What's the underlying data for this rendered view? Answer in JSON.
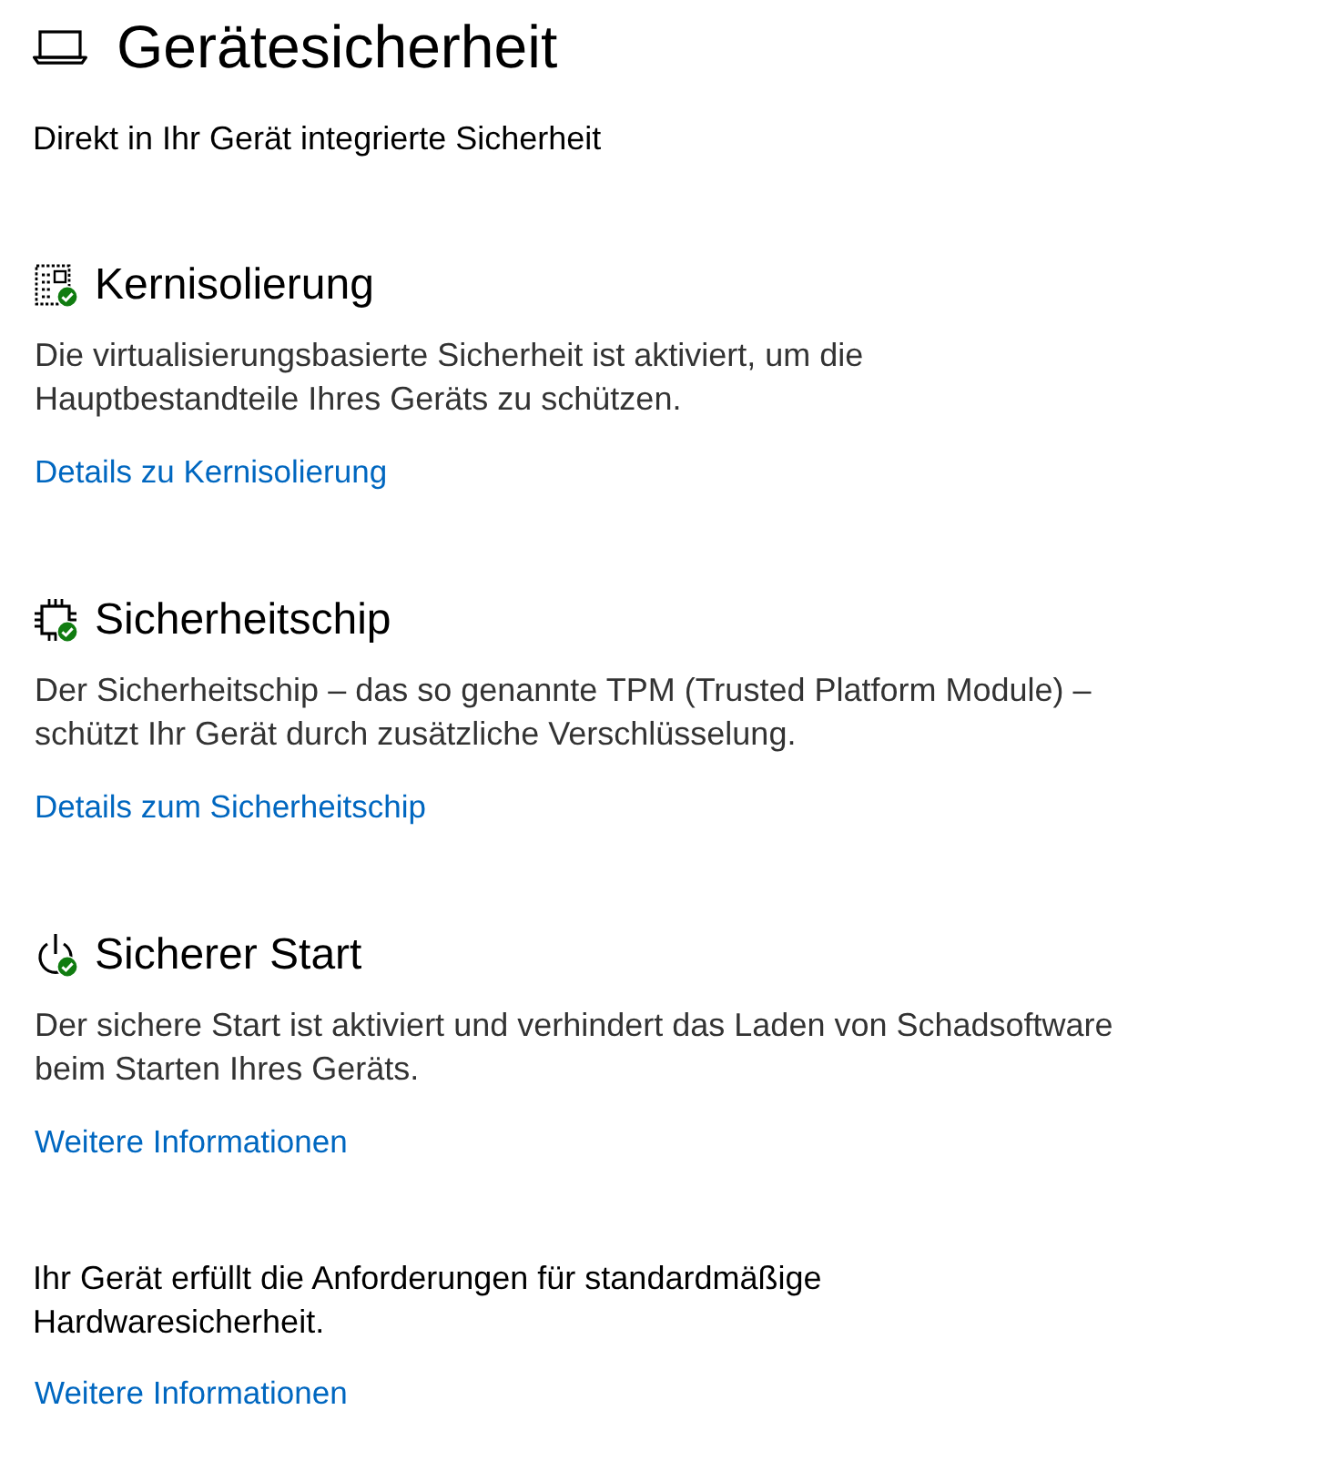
{
  "page": {
    "title": "Gerätesicherheit",
    "subtitle": "Direkt in Ihr Gerät integrierte Sicherheit"
  },
  "sections": [
    {
      "kind": "core-isolation",
      "ok": true,
      "title": "Kernisolierung",
      "description": "Die virtualisierungsbasierte Sicherheit ist aktiviert, um die\nHauptbestandteile Ihres Geräts zu schützen.",
      "link": "Details zu Kernisolierung"
    },
    {
      "kind": "security-chip",
      "ok": true,
      "title": "Sicherheitschip",
      "description": "Der Sicherheitschip – das so genannte TPM (Trusted Platform Module) –\nschützt Ihr Gerät durch zusätzliche Verschlüsselung.",
      "link": "Details zum Sicherheitschip"
    },
    {
      "kind": "secure-boot",
      "ok": true,
      "title": "Sicherer Start",
      "description": "Der sichere Start ist aktiviert und verhindert das Laden von Schadsoftware\nbeim Starten Ihres Geräts.",
      "link": "Weitere Informationen"
    }
  ],
  "summary": {
    "text": "Ihr Gerät erfüllt die Anforderungen für standardmäßige\nHardwaresicherheit.",
    "link": "Weitere Informationen"
  }
}
